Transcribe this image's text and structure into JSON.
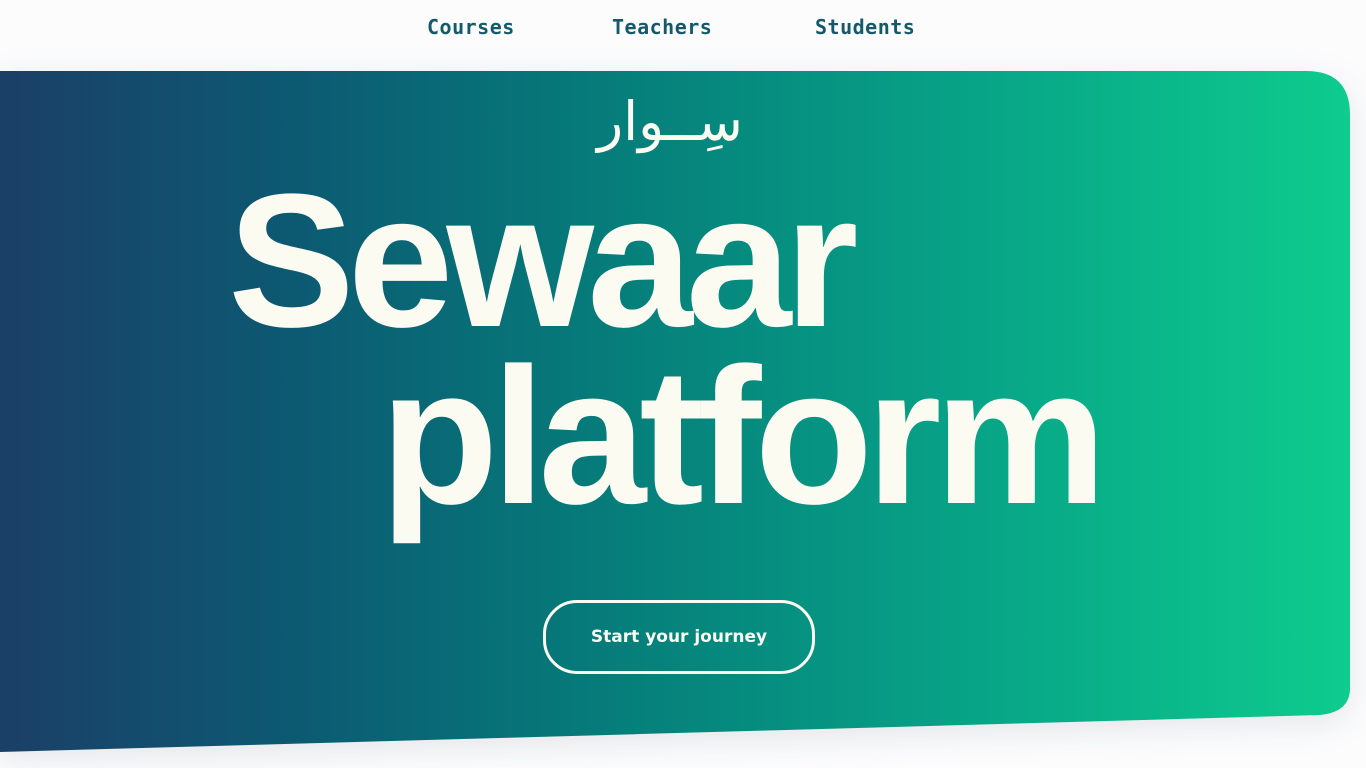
{
  "nav": {
    "items": [
      {
        "label": "Courses"
      },
      {
        "label": "Teachers"
      },
      {
        "label": "Students"
      }
    ],
    "color": "#145a6b"
  },
  "hero": {
    "arabic_logo": "سِــوار",
    "title_line1": "Sewaar",
    "title_line2": "platform",
    "cta_label": "Start your journey",
    "gradient": [
      "#1b3f68",
      "#0c5a72",
      "#067979",
      "#07a587",
      "#0ecd8e"
    ],
    "text_color": "#fbfbf2"
  }
}
